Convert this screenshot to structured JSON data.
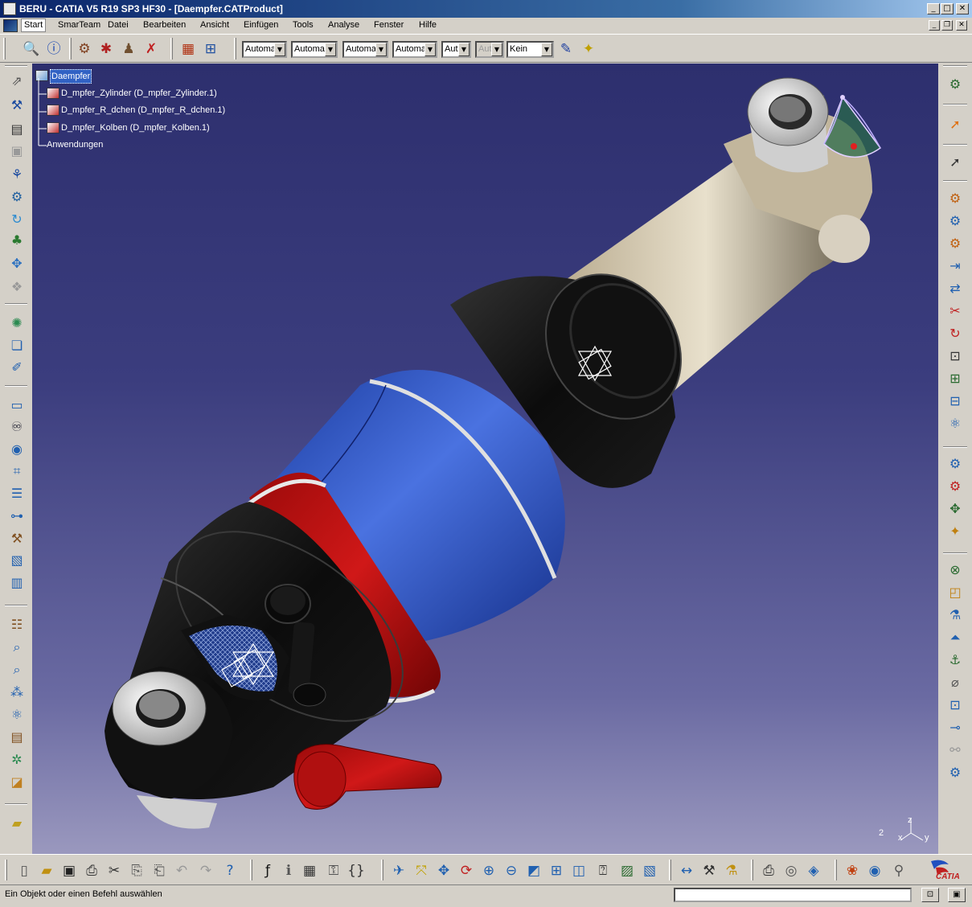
{
  "window": {
    "title": "BERU - CATIA V5 R19 SP3 HF30 - [Daempfer.CATProduct]",
    "minimize_glyph": "_",
    "maximize_glyph": "□",
    "close_glyph": "✕",
    "mdi_minimize_glyph": "_",
    "mdi_restore_glyph": "❐",
    "mdi_close_glyph": "✕"
  },
  "menu": {
    "items": [
      "Start",
      "SmarTeam",
      "Datei",
      "Bearbeiten",
      "Ansicht",
      "Einfügen",
      "Tools",
      "Analyse",
      "Fenster",
      "Hilfe"
    ]
  },
  "toolbar_top": {
    "combos": [
      "Automa",
      "Automa",
      "Automa",
      "Automa",
      "Aut",
      "Aut",
      "Kein"
    ],
    "combo_arrow": "▼"
  },
  "tree": {
    "root": "Daempfer",
    "children": [
      "D_mpfer_Zylinder (D_mpfer_Zylinder.1)",
      "D_mpfer_R_dchen (D_mpfer_R_dchen.1)",
      "D_mpfer_Kolben (D_mpfer_Kolben.1)"
    ],
    "applications": "Anwendungen"
  },
  "compass": {
    "x_label": "x",
    "y_label": "y",
    "z_label": "z",
    "number": "2"
  },
  "logo": {
    "text": "CATIA"
  },
  "status": {
    "message": "Ein Objekt oder einen Befehl auswählen",
    "command_value": ""
  },
  "icons": {
    "top": [
      "search-part-icon",
      "info-icon",
      "smarteam-save-icon",
      "smarteam-xml-icon",
      "smarteam-lock-icon",
      "smarteam-unlock-icon",
      "bom-icon",
      "tree-assembly-icon"
    ],
    "left": [
      "fix-constraint-icon",
      "coincidence-icon",
      "contact-icon",
      "offset-icon",
      "angle-icon",
      "fix-together-icon",
      "update-icon",
      "tree-icon",
      "manipulate-icon",
      "snap-icon",
      "explode-icon",
      "sectioning-icon",
      "clash-icon",
      "distance-icon",
      "measure-icon",
      "scene-icon",
      "binoculars-icon",
      "camera-icon",
      "catalog-icon",
      "swap-icon",
      "cut-icon",
      "tool-icon",
      "assembly-icon",
      "table-icon",
      "properties-icon",
      "feature-icon",
      "zoom-fit-icon",
      "analyze-icon",
      "component-icon",
      "parts-icon",
      "replicate-icon",
      "publish-icon",
      "product-icon"
    ],
    "right": [
      "gear-icon",
      "select-icon",
      "select-options-icon",
      "new-component-icon",
      "new-product-icon",
      "new-part-icon",
      "existing-component-icon",
      "replace-icon",
      "graph-tree-icon",
      "generate-numbering-icon",
      "bill-of-material-icon",
      "reorder-icon",
      "multi-instantiate-icon",
      "explode-view-icon",
      "manipulation-icon",
      "snap-icon",
      "smart-move-icon",
      "stop-manipulate-icon",
      "constraints-icon",
      "change-constraint-icon",
      "reuse-pattern-icon",
      "measure-between-icon",
      "measure-item-icon",
      "measure-inertia-icon",
      "annotation-icon",
      "weld-icon",
      "wrench-icon"
    ],
    "bottom": [
      "new-icon",
      "open-icon",
      "save-icon",
      "print-icon",
      "cut-icon",
      "copy-icon",
      "paste-icon",
      "undo-icon",
      "redo-icon",
      "whats-this-icon",
      "formula-icon",
      "knowledge-icon",
      "table-icon",
      "lock-icon",
      "macro-icon",
      "fly-mode-icon",
      "fit-all-icon",
      "pan-icon",
      "rotate-icon",
      "zoom-in-icon",
      "zoom-out-icon",
      "normal-view-icon",
      "multi-view-icon",
      "iso-view-icon",
      "hide-show-icon",
      "swap-visible-icon",
      "render-style-icon",
      "measure-icon",
      "catalog-icon",
      "part-icon",
      "snapshot-icon",
      "rotate-3d-icon",
      "material-icon",
      "photo-icon",
      "texture-icon",
      "material-apply-icon",
      "exit-icon"
    ]
  }
}
